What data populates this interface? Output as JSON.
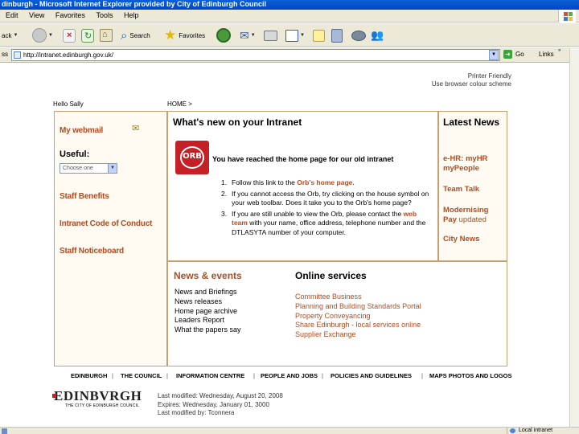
{
  "window": {
    "title": "dinburgh - Microsoft Internet Explorer provided by City of Edinburgh Council"
  },
  "menubar": [
    "Edit",
    "View",
    "Favorites",
    "Tools",
    "Help"
  ],
  "toolbar": {
    "back_label": "ack",
    "search_label": "Search",
    "favorites_label": "Favorites"
  },
  "address": {
    "label": "ss",
    "url": "http://intranet.edinburgh.gov.uk/",
    "go_label": "Go",
    "links_label": "Links"
  },
  "page": {
    "printer_friendly": "Printer Friendly",
    "colour_scheme": "Use browser colour scheme",
    "greeting": "Hello Sally",
    "breadcrumb": "HOME >",
    "left": {
      "webmail": "My webmail",
      "useful_label": "Useful:",
      "useful_selected": "Choose one",
      "links": [
        "Staff Benefits",
        "Intranet Code of Conduct",
        "Staff Noticeboard"
      ]
    },
    "whatsnew": {
      "title": "What's new on your Intranet",
      "orb_logo_text": "ORB",
      "intro_prefix": "You have reached the home page for ",
      "intro_bold": "our old intranet",
      "steps": [
        {
          "num": "1.",
          "pre": "Follow this link to the ",
          "link": "Orb's home page.",
          "post": ""
        },
        {
          "num": "2.",
          "pre": "If you cannot access the Orb, try clicking on the house symbol on your web toolbar. Does it take you to the Orb's home page?",
          "link": "",
          "post": ""
        },
        {
          "num": "3.",
          "pre": "If you are still unable to view the Orb, please contact the ",
          "link": "web team",
          "post": " with your name, office address, telephone number and the DTLASYTA number of your computer."
        }
      ]
    },
    "latest": {
      "title": "Latest News",
      "items": [
        {
          "main": "e-HR: myHR myPeople",
          "sub": ""
        },
        {
          "main": "Team Talk",
          "sub": ""
        },
        {
          "main": "Modernising Pay",
          "sub": " updated"
        },
        {
          "main": "City News",
          "sub": ""
        }
      ]
    },
    "news_events": {
      "title": "News & events",
      "items": [
        "News and Briefings",
        "News releases",
        "Home page archive",
        "Leaders Report",
        "What the papers say"
      ]
    },
    "online_services": {
      "title": "Online services",
      "items": [
        "Committee Business",
        "Planning and Building Standards Portal",
        "Property Conveyancing",
        "Share Edinburgh - local services online",
        "Supplier Exchange"
      ]
    },
    "footer_nav": [
      "EDINBURGH",
      "THE COUNCIL",
      "INFORMATION CENTRE",
      "PEOPLE AND JOBS",
      "POLICIES AND GUIDELINES",
      "MAPS PHOTOS AND LOGOS"
    ],
    "logo": {
      "word": "EDINBVRGH",
      "tagline": "THE CITY OF EDINBURGH COUNCIL"
    },
    "modified": {
      "line1": "Last modified: Wednesday, August 20, 2008",
      "line2": "Expires: Wednesday, January 01, 3000",
      "line3": "Last modified by: Tconnera"
    }
  },
  "statusbar": {
    "zone": "Local intranet"
  },
  "colors": {
    "accent": "#b34b1f",
    "panel_border": "#c8a070",
    "panel_fill": "#fffaf2",
    "orb_red": "#c42026"
  }
}
